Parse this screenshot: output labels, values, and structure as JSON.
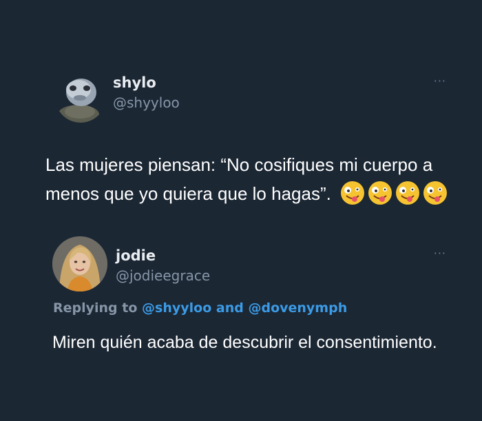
{
  "tweet": {
    "author_name": "shylo",
    "author_handle": "@shyyloo",
    "more_label": "···",
    "text": "Las mujeres piensan: “No cosifiques mi cuerpo a menos que yo quiera que lo hagas”.",
    "emoji_icon": "zany-face-icon",
    "emoji_count": 4
  },
  "reply": {
    "author_name": "jodie",
    "author_handle": "@jodieegrace",
    "more_label": "···",
    "replying_prefix": "Replying to",
    "replying_mention_1": "@shyyloo",
    "replying_joiner": "and",
    "replying_mention_2": "@dovenymph",
    "text": "Miren quién acaba de descubrir el consentimiento."
  },
  "colors": {
    "background": "#1c2734",
    "secondary_text": "#8696a7",
    "mention": "#3b9be6"
  }
}
